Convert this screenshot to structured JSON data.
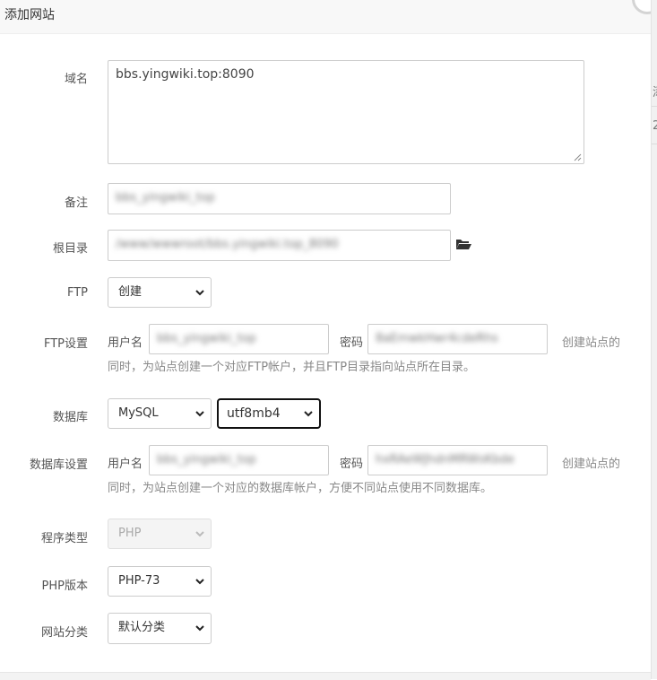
{
  "dialog": {
    "title": "添加网站"
  },
  "right_strip": {
    "frag_top": "添",
    "frag_mid": "2"
  },
  "form": {
    "domain": {
      "label": "域名",
      "value": "bbs.yingwiki.top:8090"
    },
    "note": {
      "label": "备注",
      "value": "bbs_yingwiki_top"
    },
    "root": {
      "label": "根目录",
      "value": "/www/wwwroot/bbs.yingwiki.top_8090"
    },
    "ftp": {
      "label": "FTP",
      "selected": "创建"
    },
    "ftp_settings": {
      "label": "FTP设置",
      "user_label": "用户名",
      "user_value": "bbs_yingwiki_top",
      "pass_label": "密码",
      "pass_value": "8aEmwkHwr4cdeRhs",
      "hint_right": "创建站点的",
      "hint_line2": "同时，为站点创建一个对应FTP帐户，并且FTP目录指向站点所在目录。"
    },
    "database": {
      "label": "数据库",
      "engine": "MySQL",
      "charset": "utf8mb4"
    },
    "db_settings": {
      "label": "数据库设置",
      "user_label": "用户名",
      "user_value": "bbs_yingwiki_top",
      "pass_label": "密码",
      "pass_value": "hxRAeWJhdnMRWsKbde",
      "hint_right": "创建站点的",
      "hint_line2": "同时，为站点创建一个对应的数据库帐户，方便不同站点使用不同数据库。"
    },
    "program_type": {
      "label": "程序类型",
      "selected": "PHP"
    },
    "php_version": {
      "label": "PHP版本",
      "selected": "PHP-73"
    },
    "site_category": {
      "label": "网站分类",
      "selected": "默认分类"
    }
  }
}
